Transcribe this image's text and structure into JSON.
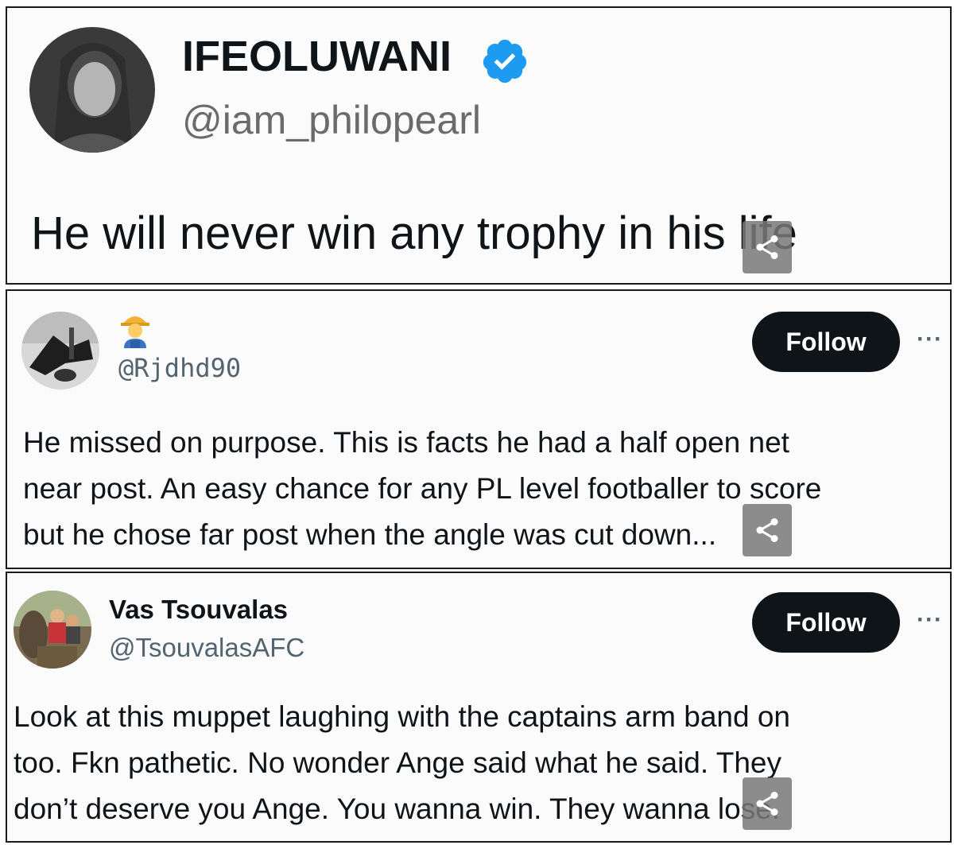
{
  "tweets": [
    {
      "display_name": "IFEOLUWANI",
      "handle": "@iam_philopearl",
      "verified": true,
      "text": "He will never win any trophy in his life"
    },
    {
      "display_name": "",
      "name_emoji": "man-farmer-emoji",
      "handle": "@Rjdhd90",
      "follow_label": "Follow",
      "text": "He missed on purpose. This is facts he had a half open net\nnear post. An easy chance for any PL level footballer to score\nbut he chose far post when the angle was cut down..."
    },
    {
      "display_name": "Vas Tsouvalas",
      "handle": "@TsouvalasAFC",
      "follow_label": "Follow",
      "text": "Look at this muppet laughing with the captains arm band on\ntoo. Fkn pathetic. No wonder Ange said what he said. They\ndon’t deserve you Ange. You wanna win. They wanna lose."
    }
  ],
  "icons": {
    "verified": "verified-badge-icon",
    "share": "share-icon",
    "more": "more-options-icon"
  },
  "colors": {
    "verified_blue": "#1d9bf0",
    "follow_bg": "#0f1419",
    "handle_gray": "#536471"
  }
}
